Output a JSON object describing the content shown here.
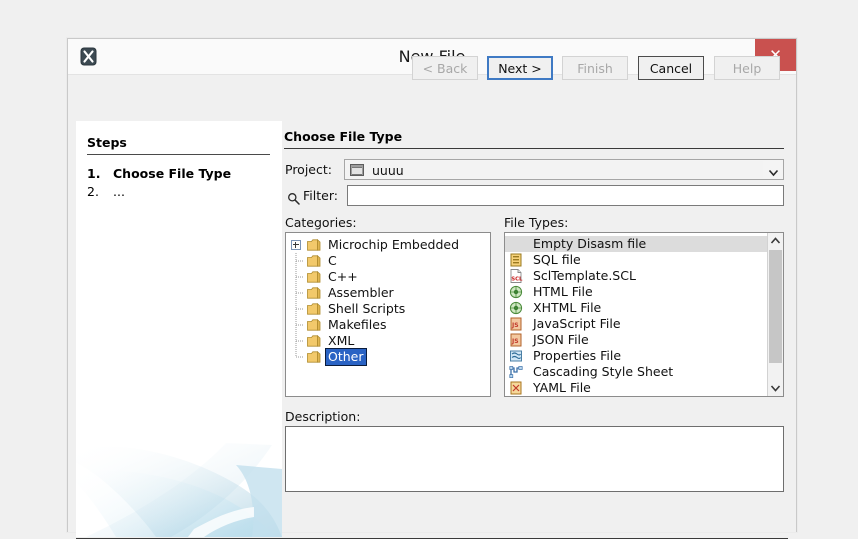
{
  "window": {
    "title": "New File",
    "app_icon": "x-app-icon",
    "close_label": "✕"
  },
  "steps": {
    "heading": "Steps",
    "items": [
      {
        "num": "1.",
        "label": "Choose File Type",
        "active": true
      },
      {
        "num": "2.",
        "label": "...",
        "active": false
      }
    ]
  },
  "main": {
    "section_title": "Choose File Type",
    "project": {
      "label": "Project:",
      "value": "uuuu",
      "icon": "project-icon",
      "arrow": "chevron-down-icon"
    },
    "filter": {
      "label": "Filter:",
      "value": "",
      "placeholder": "",
      "icon": "search-icon"
    },
    "categories": {
      "label": "Categories:",
      "items": [
        {
          "label": "Microchip Embedded",
          "expandable": true,
          "selected": false
        },
        {
          "label": "C",
          "expandable": false,
          "selected": false
        },
        {
          "label": "C++",
          "expandable": false,
          "selected": false
        },
        {
          "label": "Assembler",
          "expandable": false,
          "selected": false
        },
        {
          "label": "Shell Scripts",
          "expandable": false,
          "selected": false
        },
        {
          "label": "Makefiles",
          "expandable": false,
          "selected": false
        },
        {
          "label": "XML",
          "expandable": false,
          "selected": false
        },
        {
          "label": "Other",
          "expandable": false,
          "selected": true
        }
      ]
    },
    "file_types": {
      "label": "File Types:",
      "items": [
        {
          "label": "Empty Disasm file",
          "icon": "none-icon",
          "selected": true
        },
        {
          "label": "SQL file",
          "icon": "sql-file-icon",
          "selected": false
        },
        {
          "label": "SclTemplate.SCL",
          "icon": "scl-file-icon",
          "selected": false
        },
        {
          "label": "HTML File",
          "icon": "html-file-icon",
          "selected": false
        },
        {
          "label": "XHTML File",
          "icon": "html-file-icon",
          "selected": false
        },
        {
          "label": "JavaScript File",
          "icon": "js-file-icon",
          "selected": false
        },
        {
          "label": "JSON File",
          "icon": "js-file-icon",
          "selected": false
        },
        {
          "label": "Properties File",
          "icon": "properties-file-icon",
          "selected": false
        },
        {
          "label": "Cascading Style Sheet",
          "icon": "css-file-icon",
          "selected": false
        },
        {
          "label": "YAML File",
          "icon": "yaml-file-icon",
          "selected": false
        }
      ],
      "scrollbar": {
        "up_arrow": "chevron-up-icon",
        "down_arrow": "chevron-down-icon"
      }
    },
    "description": {
      "label": "Description:",
      "value": ""
    }
  },
  "buttons": {
    "back": {
      "label": "< Back",
      "state": "disabled"
    },
    "next": {
      "label": "Next >",
      "state": "default"
    },
    "finish": {
      "label": "Finish",
      "state": "disabled"
    },
    "cancel": {
      "label": "Cancel",
      "state": "normal"
    },
    "help": {
      "label": "Help",
      "state": "disabled"
    }
  },
  "colors": {
    "close_red": "#c9514f",
    "selection_blue": "#2a63c4",
    "focus_blue": "#3f7ac4",
    "dialog_bg": "#f0f0f0",
    "desktop_bg": "#f0f0f0"
  }
}
